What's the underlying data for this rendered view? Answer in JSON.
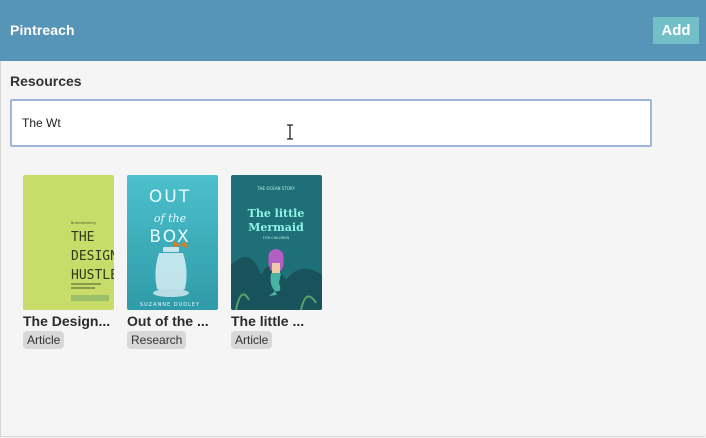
{
  "app": {
    "title": "Pintreach",
    "add_label": "Add"
  },
  "resources": {
    "heading": "Resources",
    "search": {
      "value": "The Wt",
      "placeholder": ""
    }
  },
  "cards": [
    {
      "title": "The Design...",
      "tag": "Article",
      "cover": {
        "bg": "#c8dc6a",
        "small_text": "Brainstorming",
        "lines": [
          "THE",
          "DESIGN",
          "HUSTLE"
        ]
      }
    },
    {
      "title": "Out of the ...",
      "tag": "Research",
      "cover": {
        "bg": "#3fb7c4",
        "lines": [
          "OUT",
          "of the",
          "BOX"
        ],
        "author": "SUZANNE DUDLEY"
      }
    },
    {
      "title": "The little ...",
      "tag": "Article",
      "cover": {
        "bg": "#1f6f78",
        "lines": [
          "The little",
          "Mermaid"
        ],
        "top_small": "THE OCEAN STORY",
        "bottom_small": "FOR CHILDREN"
      }
    }
  ],
  "colors": {
    "header": "#5795b8",
    "add_button": "#73bfc8",
    "search_border": "#9db6db"
  }
}
